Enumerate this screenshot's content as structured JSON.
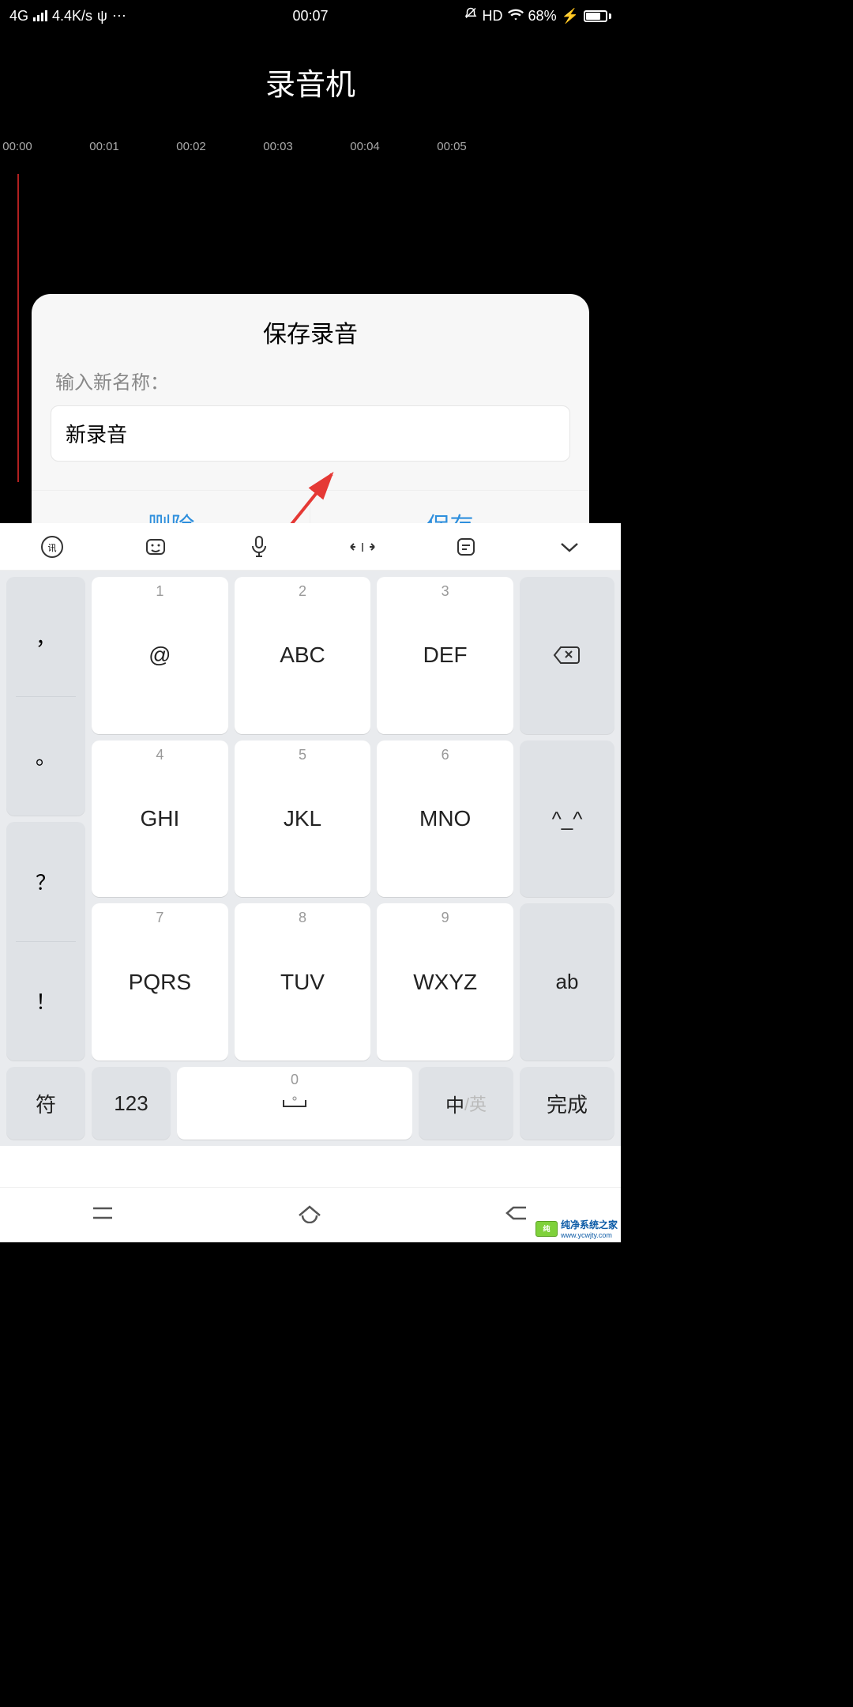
{
  "status": {
    "network": "4G",
    "speed": "4.4K/s",
    "usb": "⎋",
    "time": "00:07",
    "hd": "HD",
    "battery_pct": "68%",
    "charging": "⚡"
  },
  "app": {
    "title": "录音机"
  },
  "timeline": {
    "ticks": [
      "00:00",
      "00:01",
      "00:02",
      "00:03",
      "00:04",
      "00:05"
    ]
  },
  "dialog": {
    "title": "保存录音",
    "label": "输入新名称：",
    "value": "新录音",
    "delete": "删除",
    "save": "保存"
  },
  "keyboard": {
    "toolbar_brand": "讯飞",
    "rows": [
      [
        {
          "num": "1",
          "label": "@"
        },
        {
          "num": "2",
          "label": "ABC"
        },
        {
          "num": "3",
          "label": "DEF"
        }
      ],
      [
        {
          "num": "4",
          "label": "GHI"
        },
        {
          "num": "5",
          "label": "JKL"
        },
        {
          "num": "6",
          "label": "MNO"
        }
      ],
      [
        {
          "num": "7",
          "label": "PQRS"
        },
        {
          "num": "8",
          "label": "TUV"
        },
        {
          "num": "9",
          "label": "WXYZ"
        }
      ]
    ],
    "left_side": {
      "comma": "，",
      "period": "。",
      "question": "？",
      "exclaim": "！"
    },
    "right_side": {
      "emoji": "^_^",
      "ab": "ab"
    },
    "bottom": {
      "symbol": "符",
      "num123": "123",
      "space_num": "0",
      "lang_main": "中",
      "lang_sub": "/英",
      "done": "完成"
    }
  },
  "watermark": {
    "name": "纯净系统之家",
    "url": "www.ycwjty.com"
  }
}
